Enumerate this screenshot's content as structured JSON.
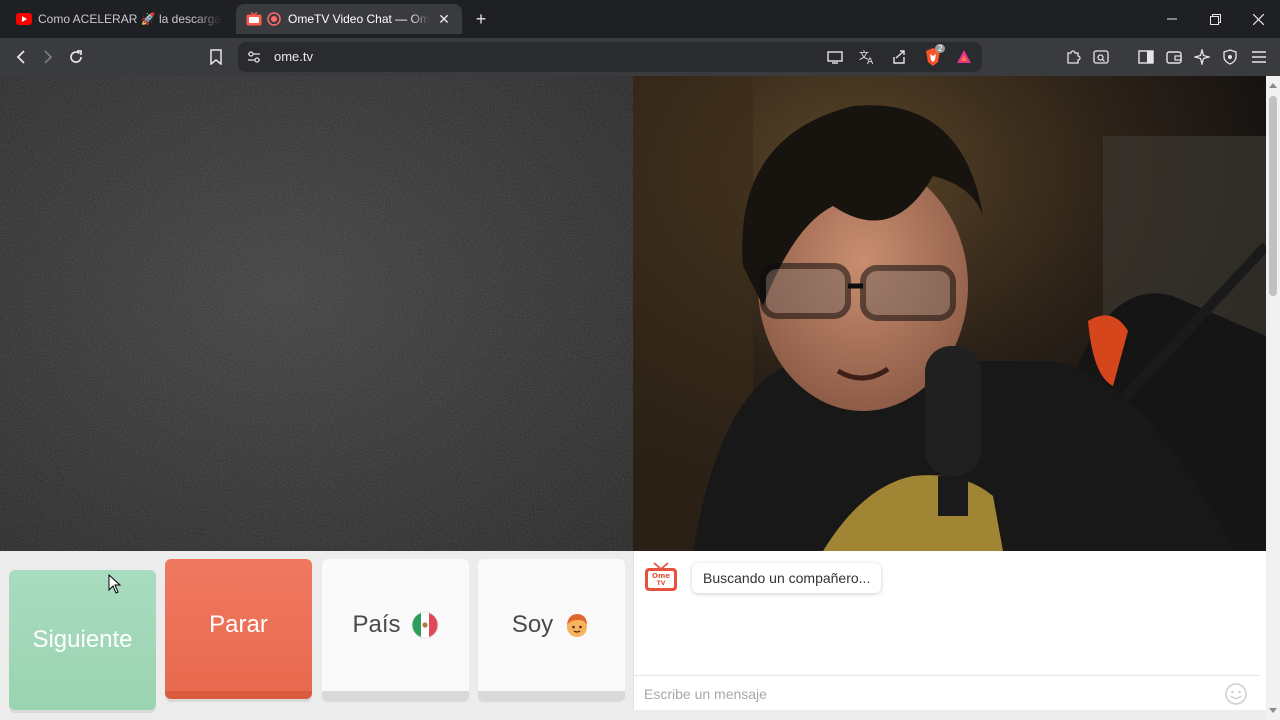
{
  "browser": {
    "tabs": [
      {
        "title": "Como ACELERAR 🚀 la descarga de",
        "favicon": "youtube-icon",
        "active": false
      },
      {
        "title": "OmeTV Video Chat — Omegl",
        "favicon": "ometv-icon",
        "active": true,
        "recording": true
      }
    ],
    "address_bar": {
      "url": "ome.tv"
    },
    "shield_badge": "2"
  },
  "page": {
    "buttons": {
      "next": "Siguiente",
      "stop": "Parar",
      "country": "País",
      "country_flag": "mexico-flag-icon",
      "iam": "Soy",
      "iam_icon": "boy-emoji-icon"
    },
    "chat": {
      "status_message": "Buscando un compañero...",
      "input_placeholder": "Escribe un mensaje"
    }
  },
  "colors": {
    "next_button": "#9ad3b1",
    "stop_button": "#e86a4f",
    "chrome_dark": "#1f2023",
    "toolbar": "#3a3b3f"
  }
}
